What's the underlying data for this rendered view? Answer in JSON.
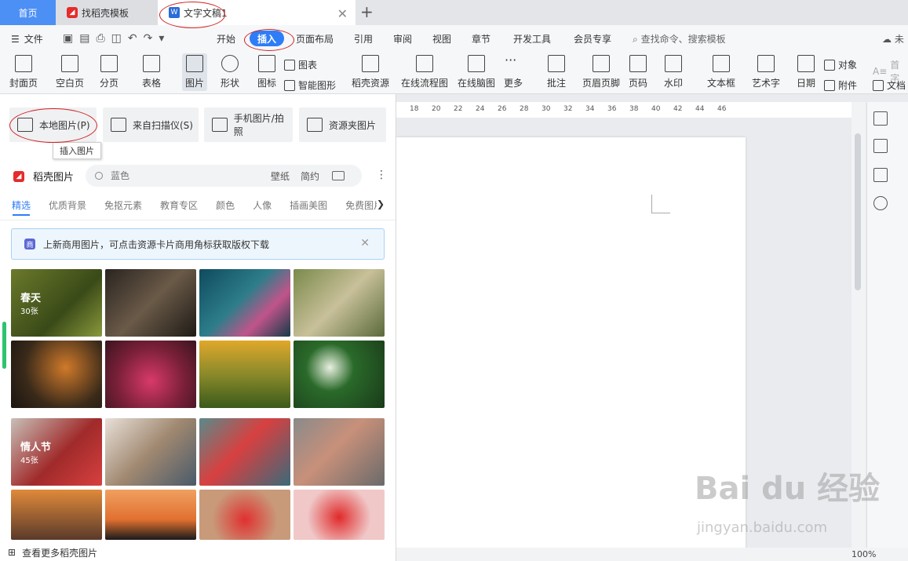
{
  "tabs": {
    "home": "首页",
    "template": "找稻壳模板",
    "document": "文字文稿1",
    "add": "+"
  },
  "menu": {
    "file": "文件",
    "items": [
      "开始",
      "插入",
      "页面布局",
      "引用",
      "审阅",
      "视图",
      "章节",
      "开发工具",
      "会员专享"
    ],
    "search": "查找命令、搜索模板",
    "right": "未"
  },
  "toolbar": {
    "cover": "封面页",
    "blank": "空白页",
    "pagebreak": "分页",
    "table": "表格",
    "picture": "图片",
    "shape": "形状",
    "icon": "图标",
    "chart": "图表",
    "smartart": "智能图形",
    "resource": "稻壳资源",
    "flowchart": "在线流程图",
    "mindmap": "在线脑图",
    "more": "更多",
    "comment": "批注",
    "header_footer": "页眉页脚",
    "page_number": "页码",
    "watermark": "水印",
    "textbox": "文本框",
    "wordart": "艺术字",
    "date": "日期",
    "object": "对象",
    "attachment": "附件",
    "dropcap": "首字",
    "docpart": "文档"
  },
  "ruler": [
    "18",
    "20",
    "22",
    "24",
    "26",
    "28",
    "30",
    "32",
    "34",
    "36",
    "38",
    "40",
    "42",
    "44",
    "46"
  ],
  "panel": {
    "sources": [
      "本地图片(P)",
      "来自扫描仪(S)",
      "手机图片/拍照",
      "资源夹图片"
    ],
    "tooltip": "插入图片",
    "brand": "稻壳图片",
    "search_placeholder": "蓝色",
    "search_tags": [
      "壁纸",
      "简约"
    ],
    "categories": [
      "精选",
      "优质背景",
      "免抠元素",
      "教育专区",
      "颜色",
      "人像",
      "插画美图",
      "免费图片"
    ],
    "notice": "上新商用图片，可点击资源卡片商用角标获取版权下载",
    "collections": [
      {
        "title": "春天",
        "count": "30张"
      },
      {
        "title": "情人节",
        "count": "45张"
      }
    ],
    "footer": "查看更多稻壳图片"
  },
  "status": {
    "zoom": "100%"
  },
  "watermark": {
    "main": "Bai du 经验",
    "sub": "jingyan.baidu.com"
  },
  "colors": {
    "accent": "#2f7df6",
    "home_tab": "#4c8ff5",
    "annotation": "#d0221f"
  }
}
